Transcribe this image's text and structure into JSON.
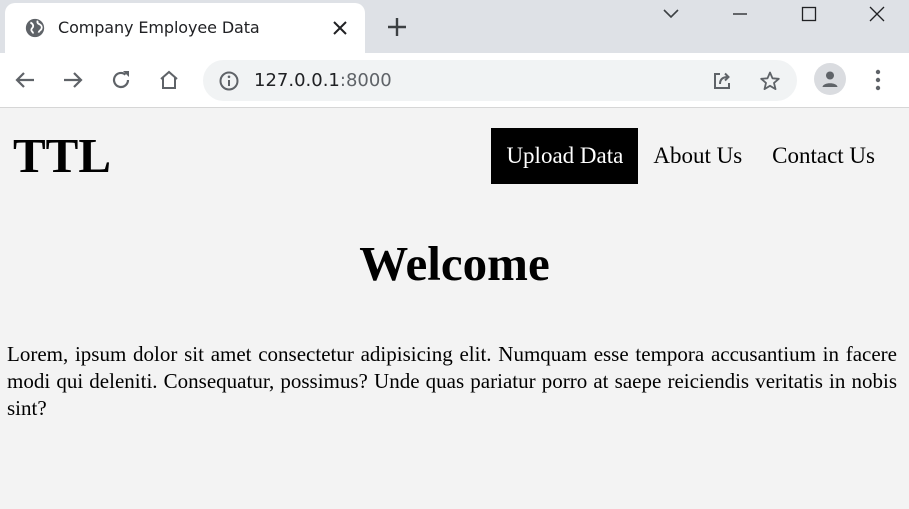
{
  "browser": {
    "tab": {
      "title": "Company Employee Data"
    },
    "address": {
      "host": "127.0.0.1",
      "port": ":8000"
    }
  },
  "site": {
    "logo": "TTL",
    "nav": [
      {
        "label": "Upload Data",
        "active": true
      },
      {
        "label": "About Us",
        "active": false
      },
      {
        "label": "Contact Us",
        "active": false
      }
    ],
    "heading": "Welcome",
    "paragraph": "Lorem, ipsum dolor sit amet consectetur adipisicing elit. Numquam esse tempora accusantium in facere modi qui deleniti. Consequatur, possimus? Unde quas pariatur porro at saepe reiciendis veritatis in nobis sint?"
  },
  "icons": {
    "favicon": "globe-icon",
    "tab_close": "close-icon",
    "new_tab": "plus-icon",
    "tab_search": "chevron-down-icon",
    "minimize": "minimize-icon",
    "maximize": "maximize-icon",
    "close_window": "close-window-icon",
    "back": "back-arrow-icon",
    "forward": "forward-arrow-icon",
    "reload": "reload-icon",
    "home": "home-icon",
    "site_info": "info-icon",
    "share": "share-icon",
    "bookmark": "star-icon",
    "profile": "profile-icon",
    "menu": "kebab-menu-icon"
  }
}
